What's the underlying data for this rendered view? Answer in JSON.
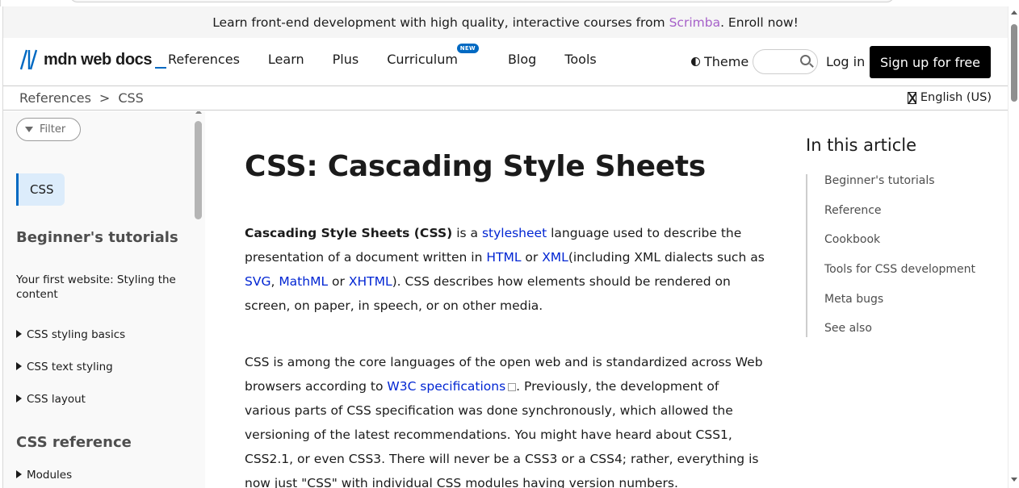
{
  "banner": {
    "prefix": "Learn front-end development with high quality, interactive courses from",
    "link": "Scrimba",
    "suffix": ". Enroll now!"
  },
  "header": {
    "logo_text": "mdn web docs",
    "nav": [
      "References",
      "Learn",
      "Plus",
      "Curriculum",
      "Blog",
      "Tools"
    ],
    "new_badge": "NEW",
    "theme_label": "Theme",
    "login_label": "Log in",
    "signup_label": "Sign up for free"
  },
  "breadcrumb": {
    "items": [
      "References",
      ">",
      "CSS"
    ],
    "language": "English (US)"
  },
  "sidebar": {
    "filter_placeholder": "Filter",
    "active_item": "CSS",
    "sections": [
      {
        "heading": "Beginner's tutorials"
      },
      {
        "heading": "CSS reference"
      }
    ],
    "items": [
      {
        "label": "Your first website: Styling the content",
        "expandable": false
      },
      {
        "label": "CSS styling basics",
        "expandable": true
      },
      {
        "label": "CSS text styling",
        "expandable": true
      },
      {
        "label": "CSS layout",
        "expandable": true
      },
      {
        "label": "Modules",
        "expandable": true
      }
    ]
  },
  "article": {
    "title": "CSS: Cascading Style Sheets",
    "p1": {
      "bold": "Cascading Style Sheets (CSS)",
      "t1": " is a ",
      "l1": "stylesheet",
      "t2": " language used to describe the presentation of a document written in ",
      "l2": "HTML",
      "t3": " or ",
      "l3": "XML",
      "t4": "(including XML dialects such as ",
      "l4": "SVG",
      "t5": ", ",
      "l5": "MathML",
      "t6": " or ",
      "l6": "XHTML",
      "t7": "). CSS describes how elements should be rendered on screen, on paper, in speech, or on other media."
    },
    "p2": {
      "t1": "CSS is among the core languages of the open web and is standardized across Web browsers according to ",
      "l1": "W3C specifications",
      "t2": ". Previously, the development of various parts of CSS specification was done synchronously, which allowed the versioning of the latest recommendations. You might have heard about CSS1, CSS2.1, or even CSS3. There will never be a CSS3 or a CSS4; rather, everything is now just \"CSS\" with individual CSS modules having version numbers."
    }
  },
  "toc": {
    "title": "In this article",
    "items": [
      "Beginner's tutorials",
      "Reference",
      "Cookbook",
      "Tools for CSS development",
      "Meta bugs",
      "See also"
    ]
  },
  "colors": {
    "accent": "#0069c2",
    "link": "#0025d3",
    "scrimba": "#a661c9"
  }
}
